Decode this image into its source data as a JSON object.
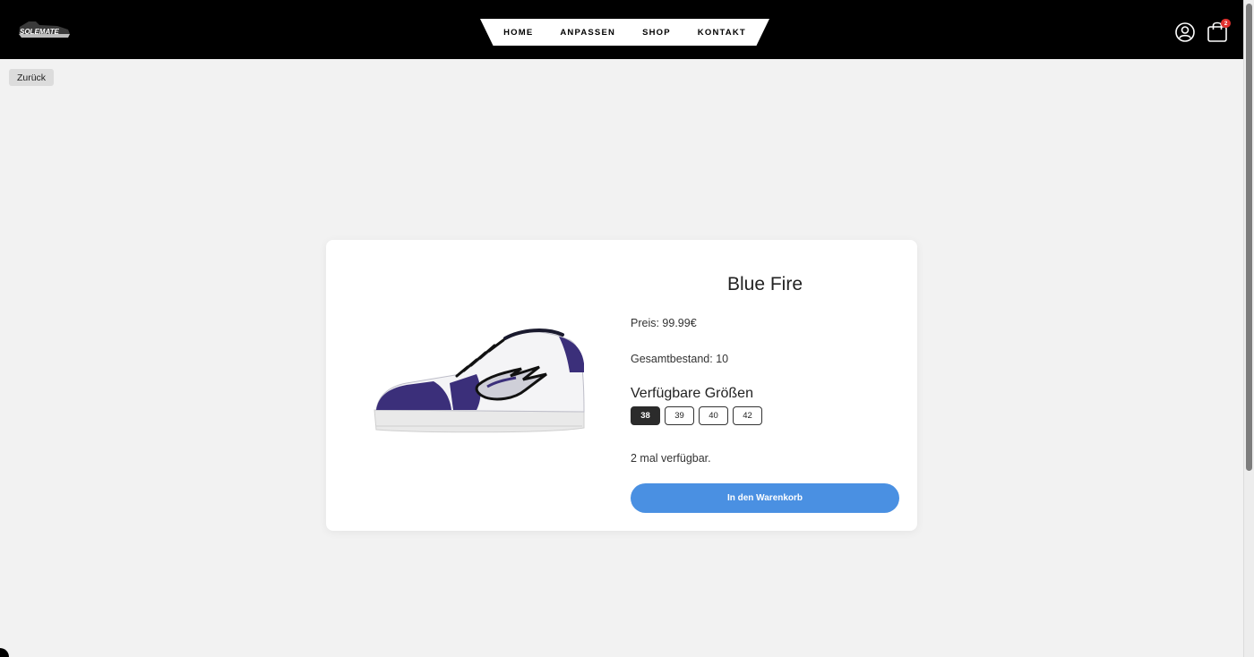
{
  "header": {
    "logo_text": "SOLEMATE",
    "nav": [
      {
        "label": "HOME"
      },
      {
        "label": "ANPASSEN"
      },
      {
        "label": "SHOP"
      },
      {
        "label": "KONTAKT"
      }
    ],
    "cart_count": "2",
    "icons": {
      "account": "user-circle-icon",
      "cart": "shopping-bag-icon"
    }
  },
  "back_button": {
    "label": "Zurück"
  },
  "product": {
    "title": "Blue Fire",
    "price": "Preis: 99.99€",
    "stock": "Gesamtbestand: 10",
    "sizes_heading": "Verfügbare Größen",
    "sizes": [
      {
        "label": "38",
        "selected": true
      },
      {
        "label": "39",
        "selected": false
      },
      {
        "label": "40",
        "selected": false
      },
      {
        "label": "42",
        "selected": false
      }
    ],
    "availability": "2 mal verfügbar.",
    "add_to_cart_label": "In den Warenkorb",
    "colors": {
      "primary": "#3b2f7a",
      "accent_button": "#4a90e2"
    }
  }
}
